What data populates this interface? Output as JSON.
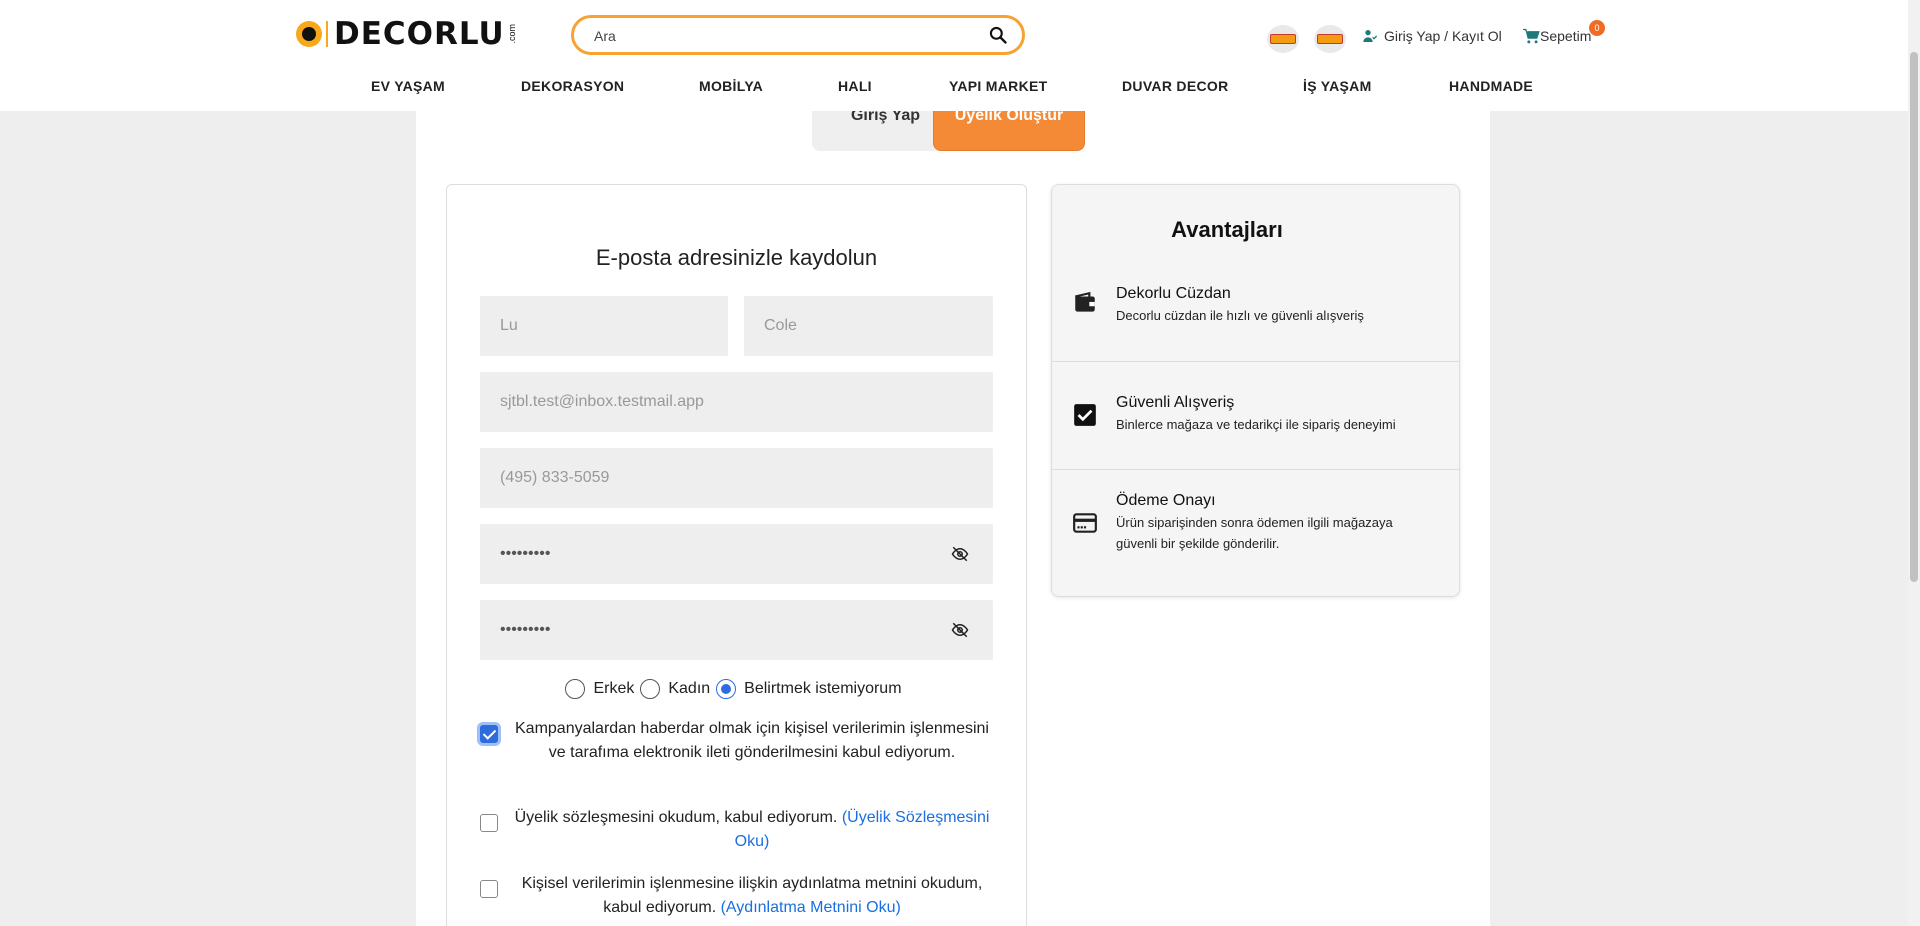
{
  "header": {
    "logo_text": "DECORLU",
    "logo_suffix": ".com",
    "search_placeholder": "Ara",
    "user_link": "Giriş Yap / Kayıt Ol",
    "cart_label": "Sepetim",
    "cart_count": "0"
  },
  "nav": [
    "EV YAŞAM",
    "DEKORASYON",
    "MOBİLYA",
    "HALI",
    "YAPI MARKET",
    "DUVAR DECOR",
    "İŞ YAŞAM",
    "HANDMADE"
  ],
  "tabs": {
    "login": "Giriş Yap",
    "register": "Üyelik Oluştur"
  },
  "form": {
    "title": "E-posta adresinizle kaydolun",
    "first_name_placeholder": "Lu",
    "last_name_placeholder": "Cole",
    "email_placeholder": "sjtbl.test@inbox.testmail.app",
    "phone_placeholder": "(495) 833-5059",
    "password_value": "•••••••••",
    "password_confirm_value": "•••••••••",
    "gender": {
      "male": "Erkek",
      "female": "Kadın",
      "unspecified": "Belirtmek istemiyorum",
      "selected": "unspecified"
    },
    "consent_campaign": "Kampanyalardan haberdar olmak için kişisel verilerimin işlenmesini ve tarafıma elektronik ileti gönderilmesini kabul ediyorum.",
    "consent_membership": "Üyelik sözleşmesini okudum, kabul ediyorum.",
    "consent_membership_link": "(Üyelik Sözleşmesini Oku)",
    "consent_privacy": "Kişisel verilerimin işlenmesine ilişkin aydınlatma metnini okudum, kabul ediyorum.",
    "consent_privacy_link": "(Aydınlatma Metnini Oku)"
  },
  "advantages": {
    "title": "Avantajları",
    "items": [
      {
        "name": "Dekorlu Cüzdan",
        "desc": "Decorlu cüzdan ile hızlı ve güvenli alışveriş",
        "icon": "wallet-icon"
      },
      {
        "name": "Güvenli Alışveriş",
        "desc": "Binlerce mağaza ve tedarikçi ile sipariş deneyimi",
        "icon": "checkbox-icon"
      },
      {
        "name": "Ödeme Onayı",
        "desc": "Ürün siparişinden sonra ödemen ilgili mağazaya güvenli bir şekilde gönderilir.",
        "icon": "credit-card-icon"
      }
    ]
  },
  "colors": {
    "accent": "#f58a36",
    "link": "#1a6fe0",
    "check": "#2d6cdf"
  }
}
